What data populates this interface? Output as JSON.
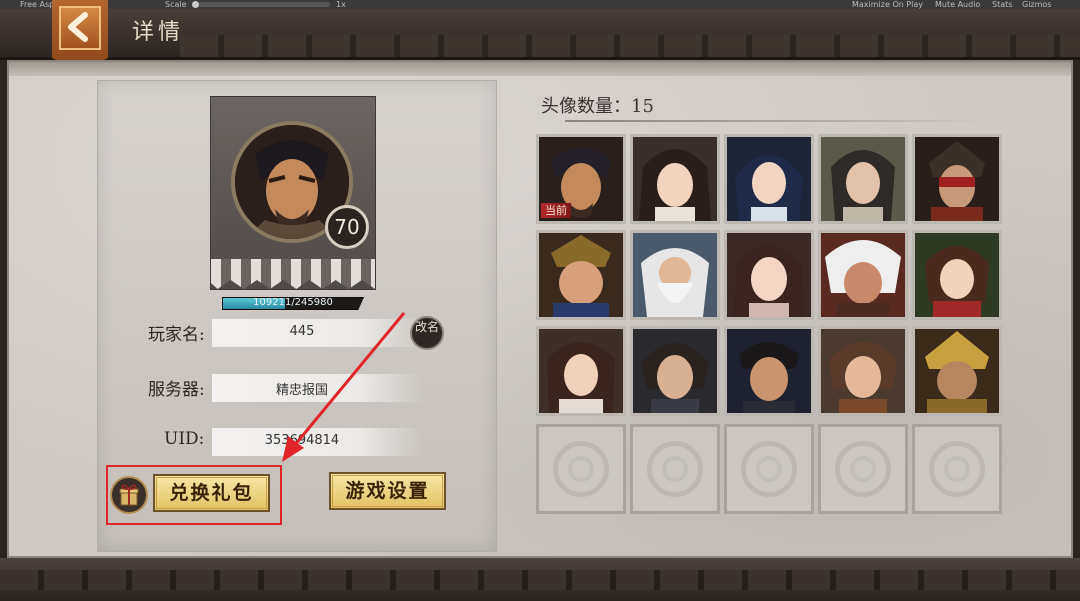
{
  "editor_bar": {
    "aspect_label": "Free Aspect",
    "scale_label": "Scale",
    "scale_value": "1x",
    "maximize_label": "Maximize On Play",
    "mute_label": "Mute Audio",
    "stats_label": "Stats",
    "gizmos_label": "Gizmos"
  },
  "header": {
    "title": "详情",
    "back_icon": "chevron-left-icon"
  },
  "player": {
    "level": "70",
    "exp_text": "109211/245980",
    "exp_fraction": 0.444,
    "name_label": "玩家名:",
    "name_value": "445",
    "rename_label": "改名",
    "server_label": "服务器:",
    "server_value": "精忠报国",
    "uid_label": "UID:",
    "uid_value": "353694814"
  },
  "buttons": {
    "redeem_label": "兑换礼包",
    "settings_label": "游戏设置",
    "gift_icon": "gift-icon"
  },
  "avatars": {
    "count_label": "头像数量：",
    "count_value": "15",
    "current_tag": "当前"
  },
  "colors": {
    "highlight": "#e0252a",
    "gold_button": "#e3c163",
    "exp_fill": "#2a8aa0"
  }
}
